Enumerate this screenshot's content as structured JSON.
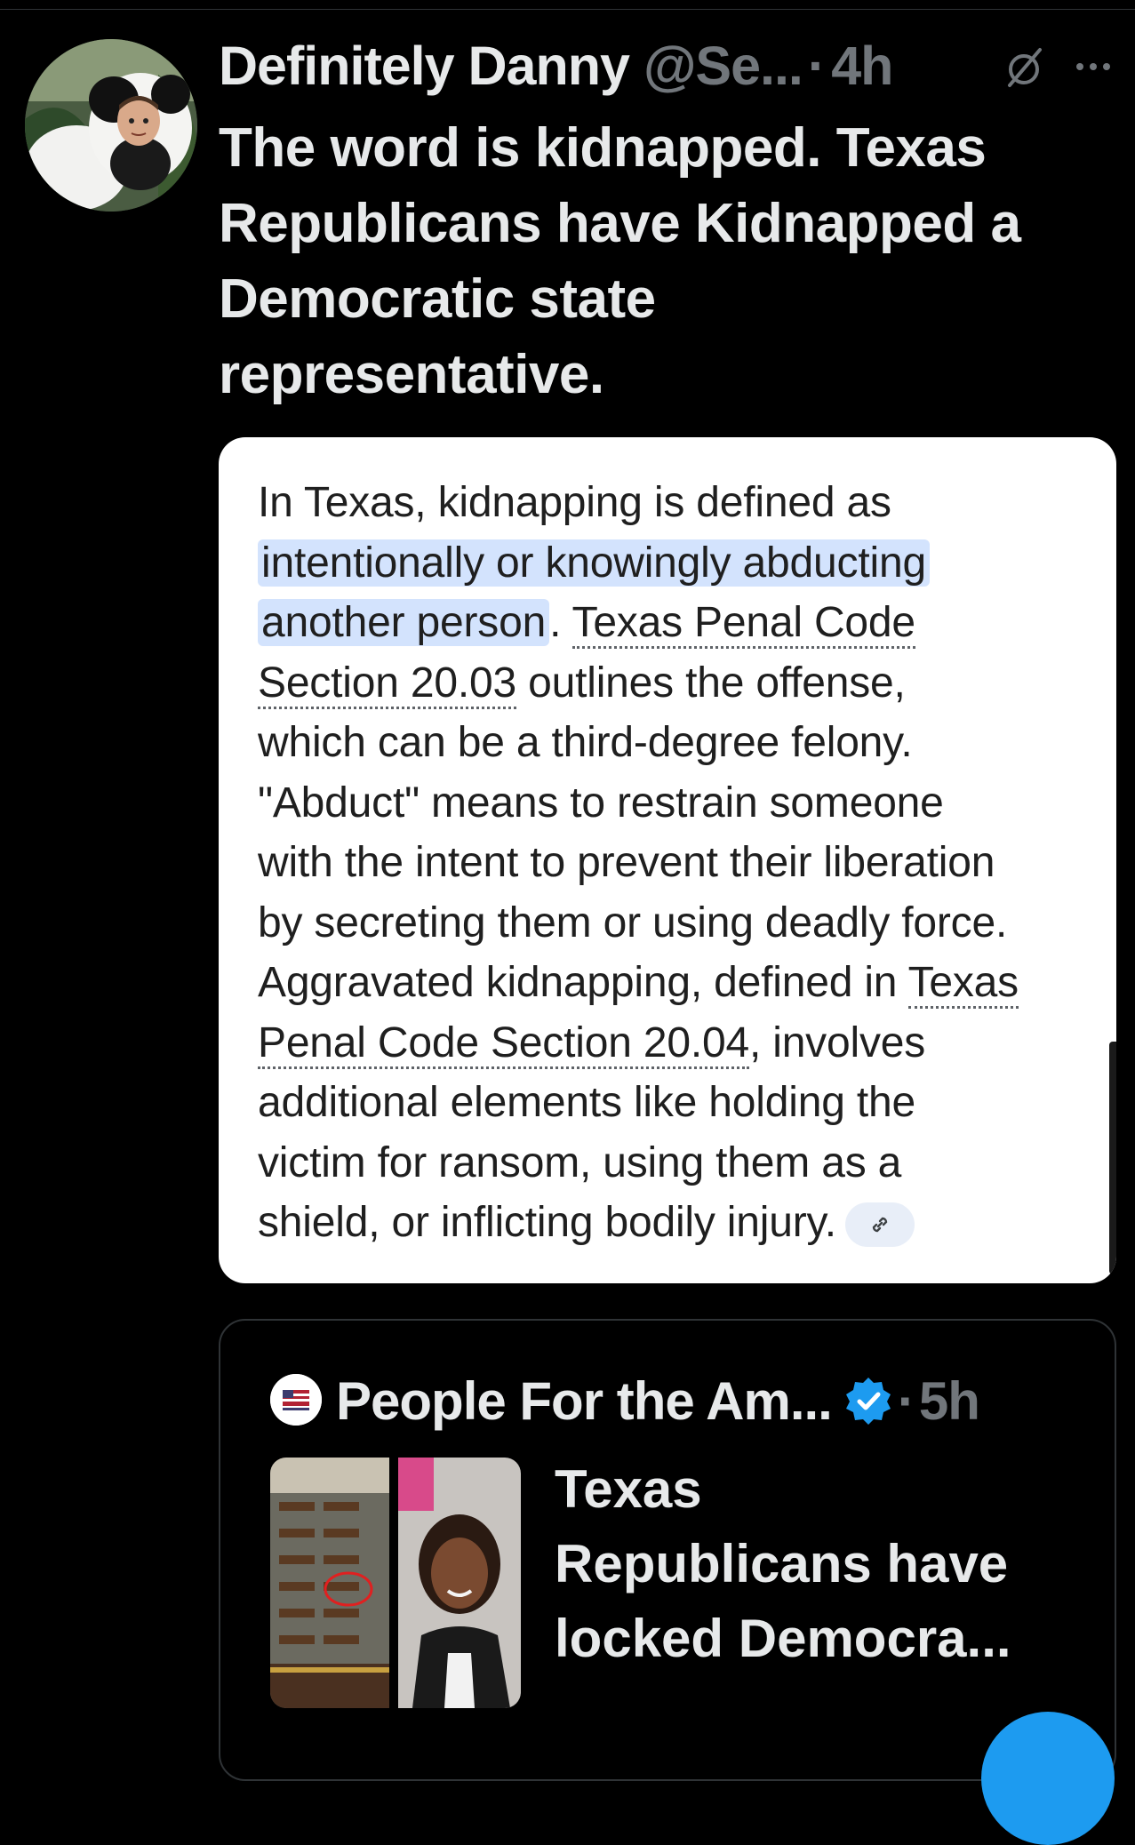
{
  "post": {
    "display_name": "Definitely Danny",
    "handle": "@Se...",
    "separator": "·",
    "time": "4h",
    "text_lines": [
      "The word is kidnapped. Texas",
      "Republicans have Kidnapped a",
      "Democratic state",
      "representative."
    ]
  },
  "card": {
    "l1": "In Texas, kidnapping is defined as",
    "l2": "intentionally or knowingly abducting",
    "l3_hl": "another person",
    "l3_dot": ". ",
    "l3_link": "Texas Penal Code",
    "l4_link": "Section 20.03",
    "l4_rest": " outlines the offense,",
    "l5": "which can be a third-degree felony.",
    "l6": "\"Abduct\" means to restrain someone",
    "l7": "with the intent to prevent their liberation",
    "l8": "by secreting them or using deadly force.",
    "l9_text": "Aggravated kidnapping, defined in ",
    "l9_link": "Texas",
    "l10_link": "Penal Code Section 20.04",
    "l10_rest": ", involves",
    "l11": "additional elements like holding the",
    "l12": "victim for ransom, using them as a",
    "l13": "shield, or inflicting bodily injury."
  },
  "quote": {
    "display_name": "People For the Am...",
    "separator": "·",
    "time": "5h",
    "text_lines": [
      "Texas",
      "Republicans have",
      "locked Democra..."
    ]
  },
  "icons": {
    "grok": "grok-icon",
    "more": "more-icon",
    "verified": "verified-badge-icon",
    "link": "link-icon"
  },
  "colors": {
    "background": "#000000",
    "primary_text": "#e7e9ea",
    "secondary_text": "#71767b",
    "highlight": "#d3e3fd",
    "verified_blue": "#1d9bf0"
  }
}
